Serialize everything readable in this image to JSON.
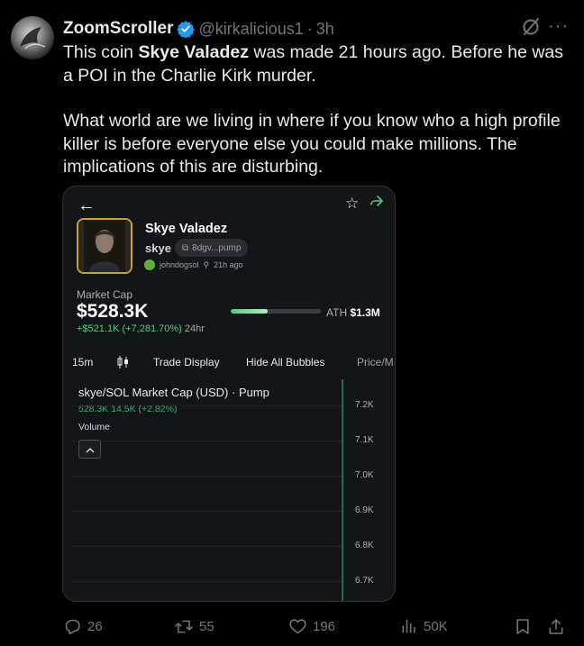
{
  "tweet": {
    "author_name": "ZoomScroller",
    "handle": "@kirkalicious1",
    "separator": "·",
    "time": "3h",
    "text_pre": "This coin ",
    "text_bold": "Skye Valadez",
    "text_post": " was made 21 hours ago. Before he was a POI in the Charlie Kirk murder.",
    "paragraph2": "What world are we living in where if you know who a high profile killer is before everyone else you could make millions. The implications of this are disturbing.",
    "icons": {
      "verified": "verified-badge-icon",
      "grok": "grok-icon",
      "more": "more-icon"
    }
  },
  "card": {
    "token_name": "Skye Valadez",
    "ticker": "skye",
    "contract": "8dgv...pump",
    "creator": "johndogsol",
    "age": "21h ago",
    "market_cap_label": "Market Cap",
    "market_cap": "$528.3K",
    "change": "+$521.1K (+7,281.70%)",
    "change_period": "24hr",
    "ath_label": "ATH",
    "ath_value": "$1.3M",
    "ath_progress": 0.41,
    "toolbar": {
      "interval": "15m",
      "trade_display": "Trade Display",
      "hide_bubbles": "Hide All Bubbles",
      "price_label": "Price/M"
    },
    "chart": {
      "title": "skye/SOL Market Cap (USD) · Pump",
      "ohlc": "528.3K  14.5K (+2.82%)",
      "volume_label": "Volume",
      "price_ticks": [
        "7.2K",
        "7.1K",
        "7.0K",
        "6.9K",
        "6.8K",
        "6.7K"
      ]
    },
    "accent_green": "#4ccf7c"
  },
  "actions": {
    "replies": "26",
    "reposts": "55",
    "likes": "196",
    "views": "50K"
  }
}
